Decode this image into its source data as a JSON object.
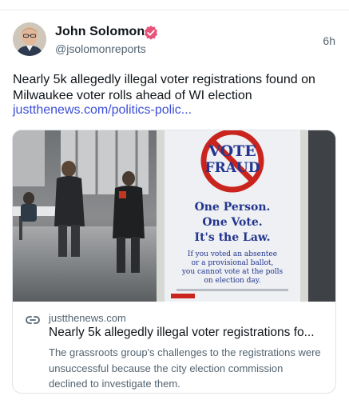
{
  "author": {
    "name": "John Solomon",
    "handle": "@jsolomonreports",
    "time": "6h",
    "verified_color": "#e8537a"
  },
  "post": {
    "text": "Nearly 5k allegedly illegal voter registrations found on Milwaukee voter rolls ahead of WI election",
    "link_text": "justthenews.com/politics-polic...",
    "link_color": "#3b4fd8"
  },
  "card": {
    "domain": "justthenews.com",
    "title": "Nearly 5k allegedly illegal voter registrations fo...",
    "description": "The grassroots group's challenges to the registrations were unsuccessful because the city election commission declined to investigate them.",
    "image": {
      "sign_title_line1": "VOTE",
      "sign_title_line2": "FRAUD",
      "sign_slogan_1": "One Person.",
      "sign_slogan_2": "One Vote.",
      "sign_slogan_3": "It's the Law.",
      "sign_body_1": "If you voted an absentee",
      "sign_body_2": "or a provisional ballot,",
      "sign_body_3": "you cannot vote at the polls",
      "sign_body_4": "on election day."
    }
  },
  "icons": {
    "avatar": "user-avatar",
    "verified": "verified-badge-icon",
    "card_link": "link-icon"
  }
}
